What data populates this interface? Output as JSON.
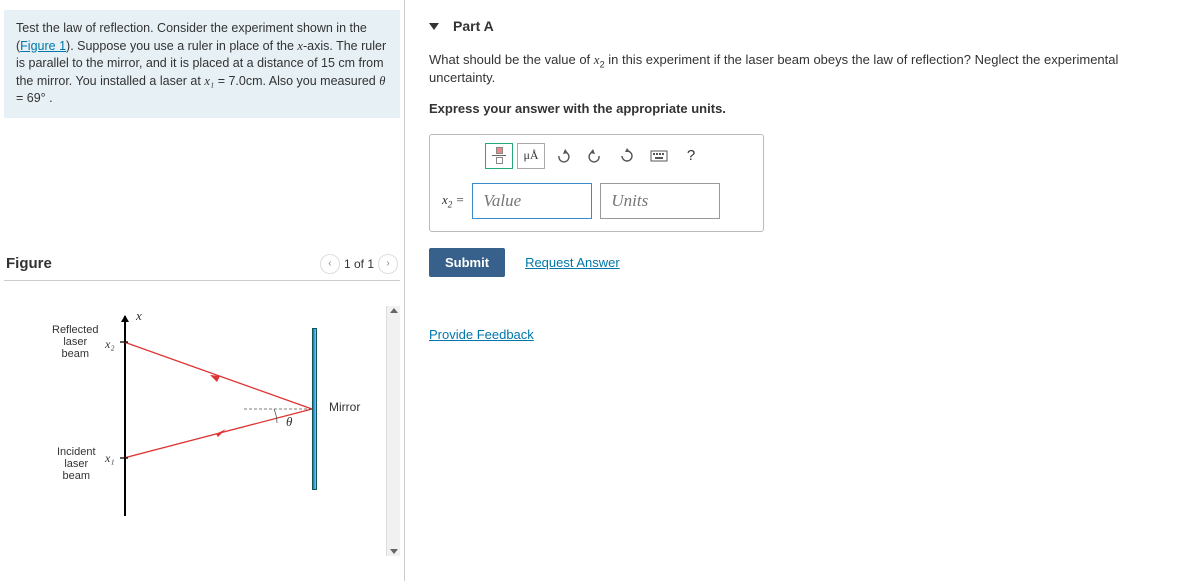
{
  "prompt": {
    "line1": "Test the law of reflection. Consider the experiment shown in the (",
    "figure_link": "Figure 1",
    "line2": "). Suppose you use a ruler in place of the ",
    "var_x": "x",
    "line3": "-axis. The ruler is parallel to the mirror, and it is placed at a distance of 15 cm from the mirror. You installed a laser at ",
    "var_x1": "x₁",
    "eq1": " = 7.0cm. Also you measured ",
    "var_theta": "θ",
    "eq2": " = 69° ."
  },
  "figure": {
    "title": "Figure",
    "counter": "1 of 1",
    "labels": {
      "x": "x",
      "x1": "x₁",
      "x2": "x₂",
      "theta": "θ",
      "mirror": "Mirror",
      "reflected": "Reflected\nlaser\nbeam",
      "incident": "Incident\nlaser\nbeam"
    }
  },
  "part": {
    "title": "Part A",
    "question": "What should be the value of x₂ in this experiment if the laser beam obeys the law of reflection? Neglect the experimental uncertainty.",
    "instruction": "Express your answer with the appropriate units.",
    "eq_label": "x₂ =",
    "value_placeholder": "Value",
    "units_placeholder": "Units",
    "toolbar": {
      "units_btn": "μÅ",
      "help_btn": "?"
    },
    "submit": "Submit",
    "request": "Request Answer"
  },
  "feedback": "Provide Feedback"
}
